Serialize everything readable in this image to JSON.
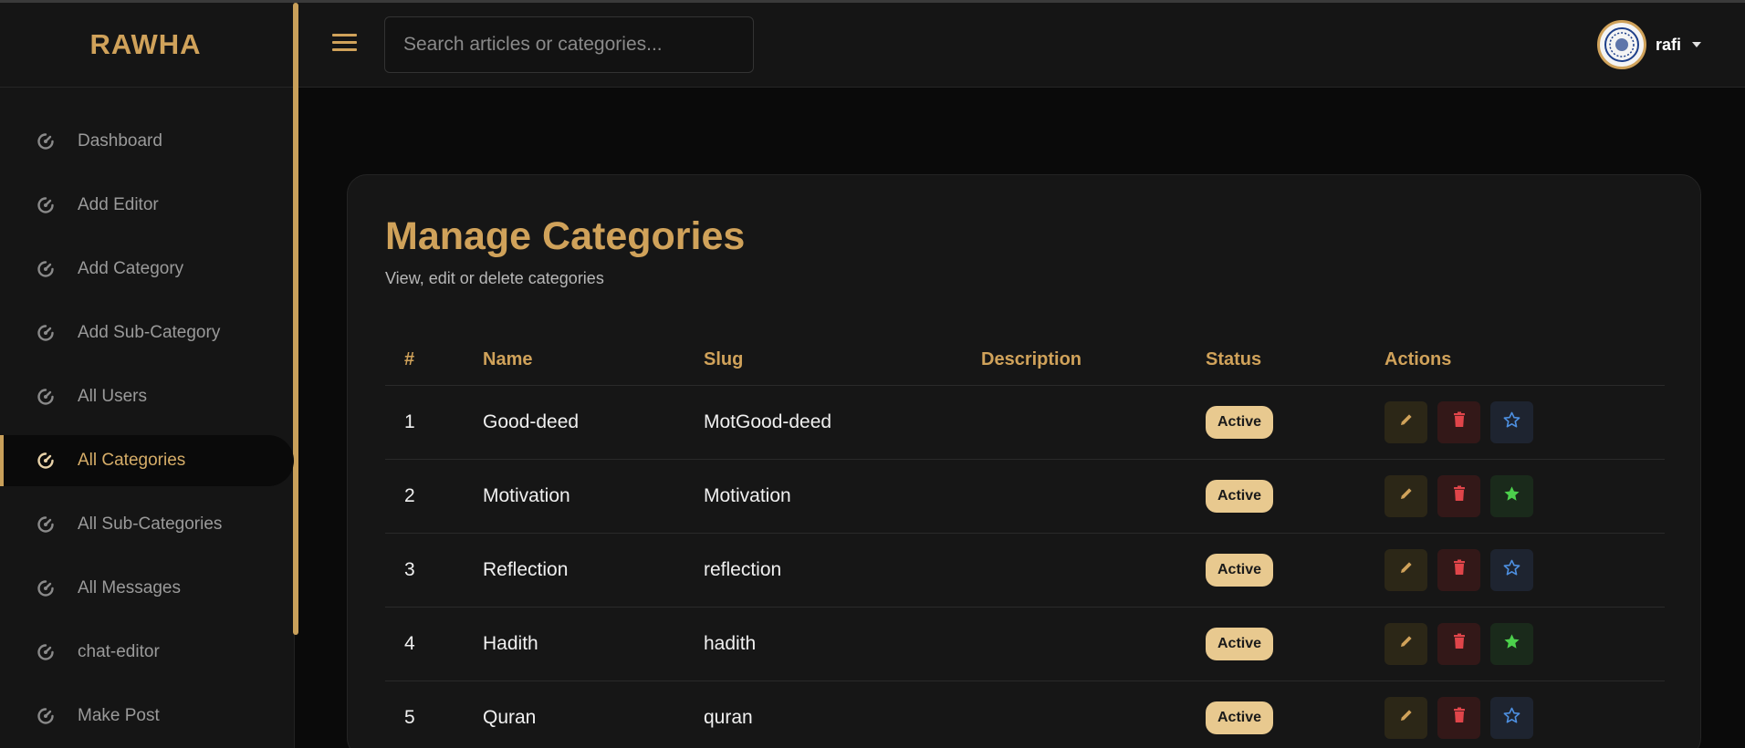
{
  "brand": "RAWHA",
  "search": {
    "placeholder": "Search articles or categories..."
  },
  "user": {
    "name": "rafi"
  },
  "sidebar": {
    "items": [
      {
        "label": "Dashboard",
        "active": false
      },
      {
        "label": "Add Editor",
        "active": false
      },
      {
        "label": "Add Category",
        "active": false
      },
      {
        "label": "Add Sub-Category",
        "active": false
      },
      {
        "label": "All Users",
        "active": false
      },
      {
        "label": "All Categories",
        "active": true
      },
      {
        "label": "All Sub-Categories",
        "active": false
      },
      {
        "label": "All Messages",
        "active": false
      },
      {
        "label": "chat-editor",
        "active": false
      },
      {
        "label": "Make Post",
        "active": false
      }
    ]
  },
  "page": {
    "title": "Manage Categories",
    "subtitle": "View, edit or delete categories"
  },
  "table": {
    "headers": [
      "#",
      "Name",
      "Slug",
      "Description",
      "Status",
      "Actions"
    ],
    "rows": [
      {
        "num": "1",
        "name": "Good-deed",
        "slug": "MotGood-deed",
        "description": "",
        "status": "Active",
        "featured": false
      },
      {
        "num": "2",
        "name": "Motivation",
        "slug": "Motivation",
        "description": "",
        "status": "Active",
        "featured": true
      },
      {
        "num": "3",
        "name": "Reflection",
        "slug": "reflection",
        "description": "",
        "status": "Active",
        "featured": false
      },
      {
        "num": "4",
        "name": "Hadith",
        "slug": "hadith",
        "description": "",
        "status": "Active",
        "featured": true
      },
      {
        "num": "5",
        "name": "Quran",
        "slug": "quran",
        "description": "",
        "status": "Active",
        "featured": false
      }
    ]
  },
  "colors": {
    "accent": "#d0a25a",
    "badge": "#e8c98f",
    "delete": "#e0454a",
    "star_on": "#4cd04c",
    "star_off": "#4d8fe0"
  },
  "icons": {
    "nav": "speedometer-icon",
    "edit": "pencil-icon",
    "delete": "trash-icon",
    "feature": "star-icon"
  }
}
